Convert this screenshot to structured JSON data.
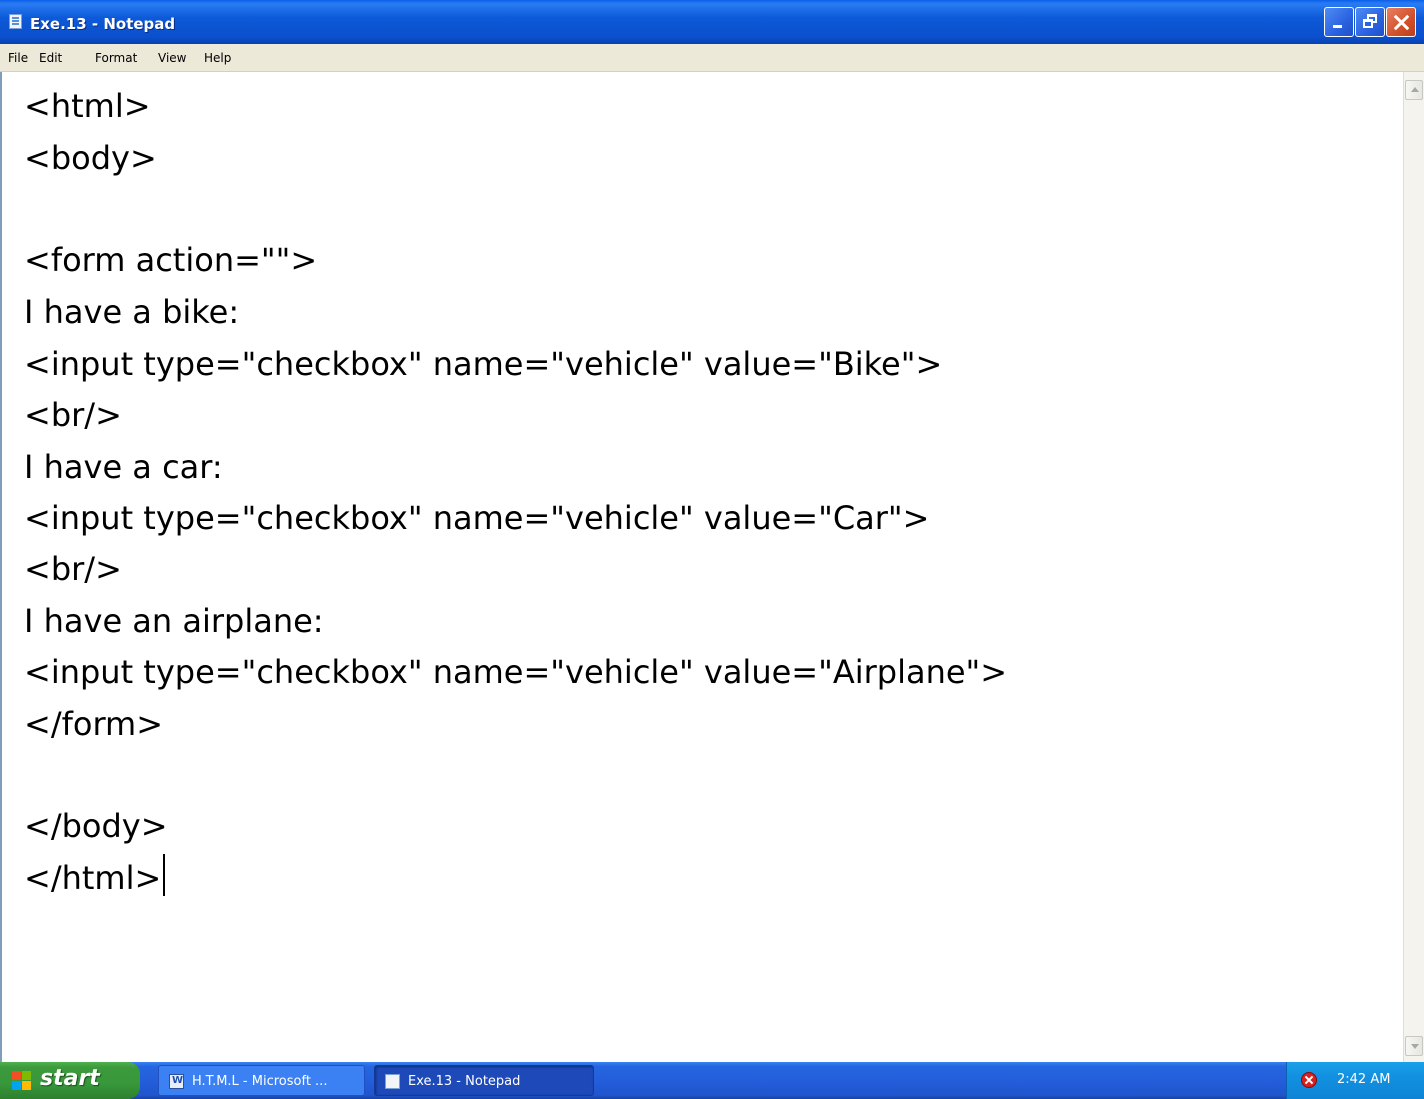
{
  "window": {
    "title": "Exe.13 - Notepad"
  },
  "menu": {
    "items": [
      "File",
      "Edit",
      "Format",
      "View",
      "Help"
    ]
  },
  "editor": {
    "lines": [
      "<html>",
      "<body>",
      "",
      "<form action=\"\">",
      "I have a bike:",
      "<input type=\"checkbox\" name=\"vehicle\" value=\"Bike\">",
      "<br/>",
      "I have a car:",
      "<input type=\"checkbox\" name=\"vehicle\" value=\"Car\">",
      "<br/>",
      "I have an airplane:",
      "<input type=\"checkbox\" name=\"vehicle\" value=\"Airplane\">",
      "</form>",
      "",
      "</body>",
      "</html>"
    ]
  },
  "taskbar": {
    "start_label": "start",
    "tasks": [
      {
        "label": "H.T.M.L - Microsoft ...",
        "icon": "word-document-icon"
      },
      {
        "label": "Exe.13 - Notepad",
        "icon": "notepad-icon",
        "active": true
      }
    ],
    "tray": {
      "security_icon": "security-alert-icon",
      "clock": "2:42 AM"
    }
  },
  "colors": {
    "titlebar": "#0b4fcc",
    "menubar": "#ece9d8",
    "taskbar": "#245edb",
    "start_button": "#37973a",
    "tray": "#1290e0"
  }
}
